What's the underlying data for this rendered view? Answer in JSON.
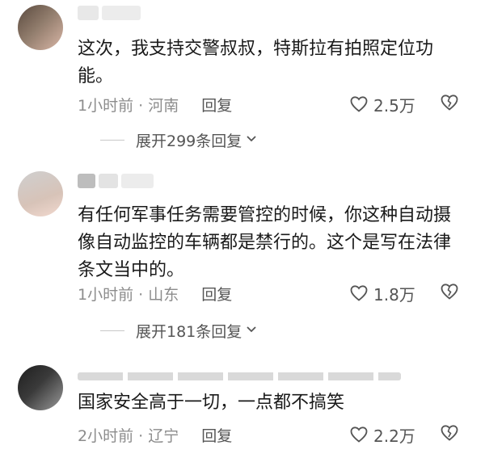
{
  "comments": [
    {
      "text": "这次，我支持交警叔叔，特斯拉有拍照定位功能。",
      "time_location": "1小时前 · 河南",
      "reply_label": "回复",
      "likes": "2.5万",
      "expand_label": "展开299条回复"
    },
    {
      "text": "有任何军事任务需要管控的时候，你这种自动摄像自动监控的车辆都是禁行的。这个是写在法律条文当中的。",
      "time_location": "1小时前 · 山东",
      "reply_label": "回复",
      "likes": "1.8万",
      "expand_label": "展开181条回复"
    },
    {
      "text": "国家安全高于一切，一点都不搞笑",
      "time_location": "2小时前 · 辽宁",
      "reply_label": "回复",
      "likes": "2.2万"
    }
  ],
  "colors": {
    "text_primary": "#1a1a1a",
    "text_secondary": "#8c8c8c",
    "action_text": "#555555"
  },
  "icons": {
    "like": "heart-outline-icon",
    "dislike": "heart-broken-outline-icon",
    "expand": "chevron-down-icon"
  }
}
